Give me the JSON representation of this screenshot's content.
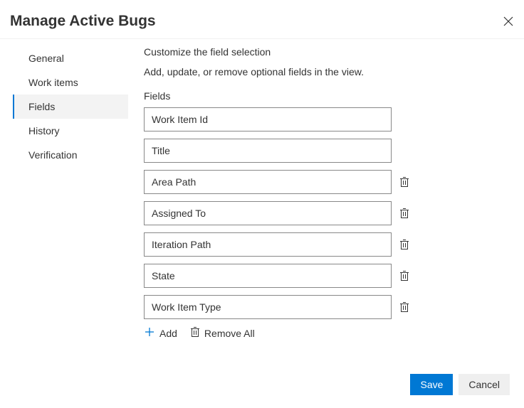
{
  "dialog": {
    "title": "Manage Active Bugs"
  },
  "sidebar": {
    "items": [
      {
        "label": "General",
        "active": false
      },
      {
        "label": "Work items",
        "active": false
      },
      {
        "label": "Fields",
        "active": true
      },
      {
        "label": "History",
        "active": false
      },
      {
        "label": "Verification",
        "active": false
      }
    ]
  },
  "main": {
    "title": "Customize the field selection",
    "subtitle": "Add, update, or remove optional fields in the view.",
    "fields_label": "Fields",
    "fields": [
      {
        "value": "Work Item Id",
        "deletable": false
      },
      {
        "value": "Title",
        "deletable": false
      },
      {
        "value": "Area Path",
        "deletable": true
      },
      {
        "value": "Assigned To",
        "deletable": true
      },
      {
        "value": "Iteration Path",
        "deletable": true
      },
      {
        "value": "State",
        "deletable": true
      },
      {
        "value": "Work Item Type",
        "deletable": true
      }
    ],
    "add_label": "Add",
    "remove_all_label": "Remove All"
  },
  "footer": {
    "save_label": "Save",
    "cancel_label": "Cancel"
  }
}
